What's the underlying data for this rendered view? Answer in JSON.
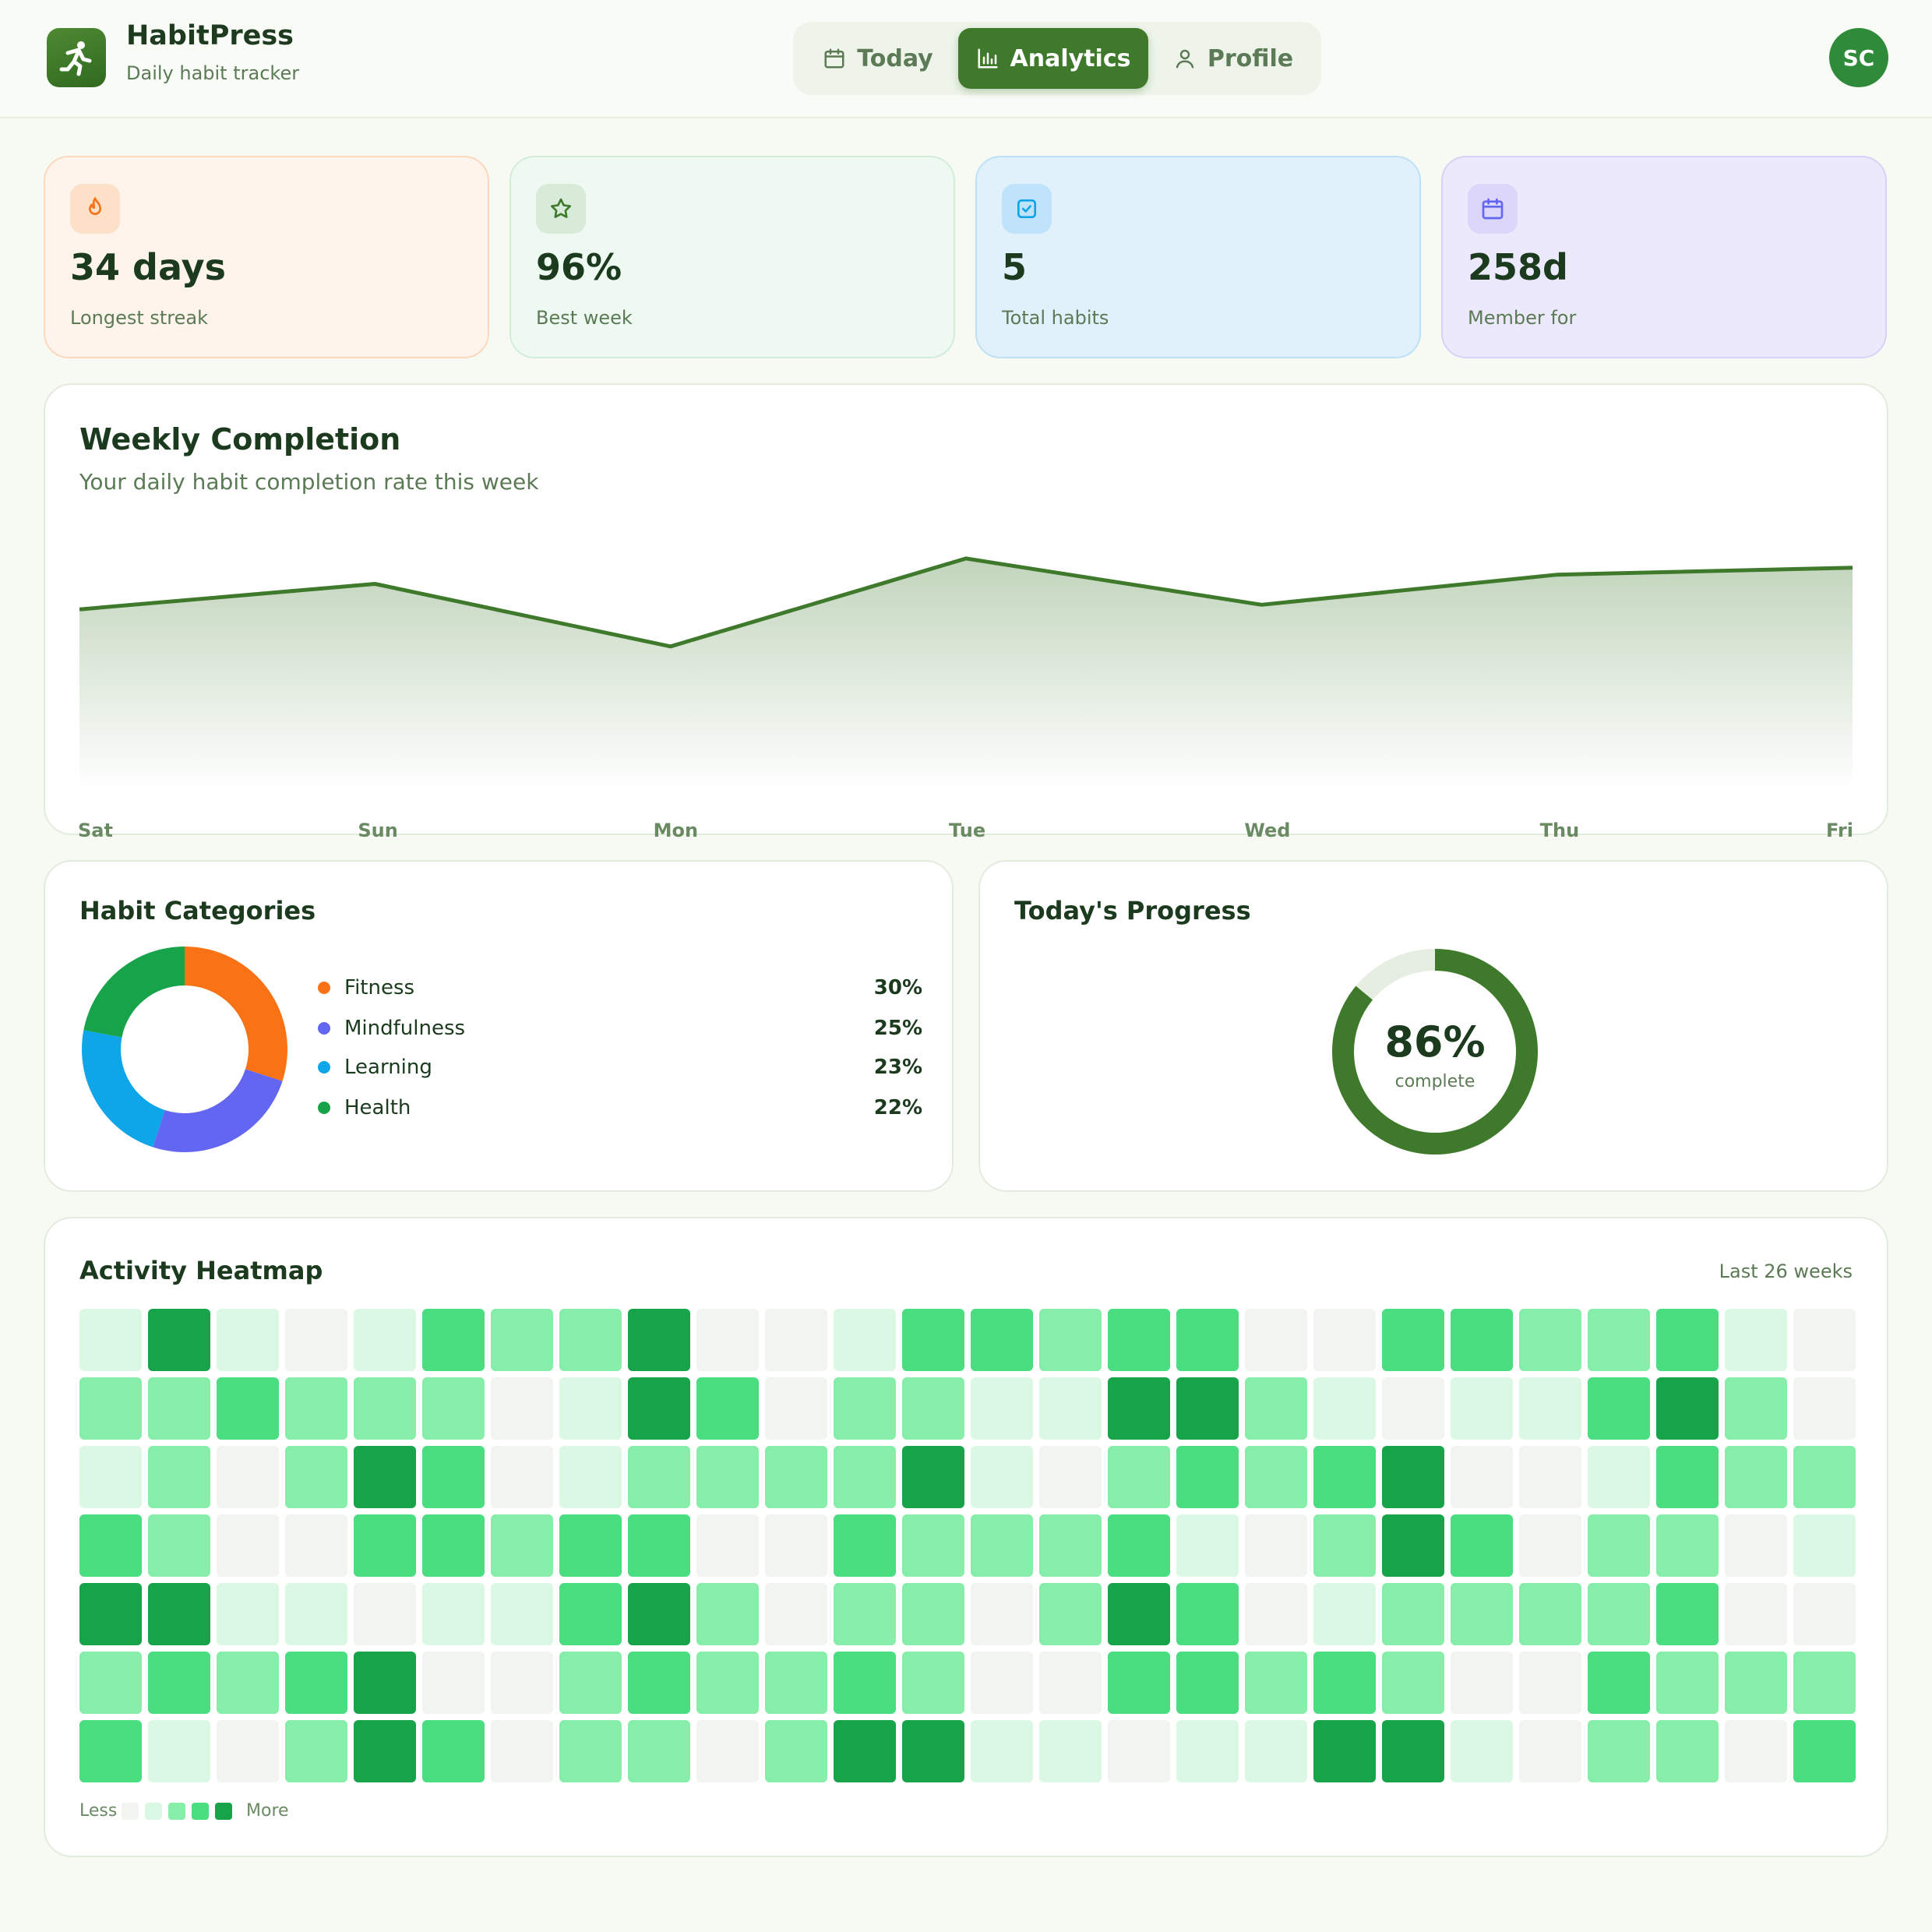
{
  "app": {
    "name": "HabitPress",
    "tagline": "Daily habit tracker",
    "avatar_initials": "SC"
  },
  "nav": {
    "tabs": [
      {
        "label": "Today",
        "icon": "calendar-icon",
        "active": false
      },
      {
        "label": "Analytics",
        "icon": "bar-chart-icon",
        "active": true
      },
      {
        "label": "Profile",
        "icon": "user-icon",
        "active": false
      }
    ]
  },
  "stats": [
    {
      "value": "34 days",
      "label": "Longest streak",
      "icon": "flame-icon",
      "color": "#f97316"
    },
    {
      "value": "96%",
      "label": "Best week",
      "icon": "star-icon",
      "color": "#3f7a2c"
    },
    {
      "value": "5",
      "label": "Total habits",
      "icon": "check-square-icon",
      "color": "#0ea5e9"
    },
    {
      "value": "258d",
      "label": "Member for",
      "icon": "calendar-icon",
      "color": "#6366f1"
    }
  ],
  "weekly": {
    "title": "Weekly Completion",
    "subtitle": "Your daily habit completion rate this week"
  },
  "chart_data": {
    "type": "area",
    "categories": [
      "Sat",
      "Sun",
      "Mon",
      "Tue",
      "Wed",
      "Thu",
      "Fri"
    ],
    "values": [
      78,
      89,
      62,
      100,
      80,
      93,
      96
    ],
    "ylim": [
      0,
      105
    ],
    "grid": false,
    "color": "#3f7a2c"
  },
  "categories": {
    "title": "Habit Categories",
    "items": [
      {
        "name": "Fitness",
        "pct": "30%",
        "value": 30,
        "color": "#f97316"
      },
      {
        "name": "Mindfulness",
        "pct": "25%",
        "value": 25,
        "color": "#6366f1"
      },
      {
        "name": "Learning",
        "pct": "23%",
        "value": 23,
        "color": "#0ea5e9"
      },
      {
        "name": "Health",
        "pct": "22%",
        "value": 22,
        "color": "#16a34a"
      }
    ]
  },
  "progress": {
    "title": "Today's Progress",
    "value": "86%",
    "fraction": 0.86,
    "label": "complete",
    "color": "#3f7a2c"
  },
  "heatmap": {
    "title": "Activity Heatmap",
    "range": "Last 26 weeks",
    "legend_less": "Less",
    "legend_more": "More",
    "rows": [
      [
        1,
        4,
        1,
        0,
        1,
        3,
        2,
        2,
        4,
        0,
        0,
        1,
        3,
        3,
        2,
        3,
        3,
        0,
        0,
        3,
        3,
        2,
        2,
        3,
        1,
        0
      ],
      [
        2,
        2,
        3,
        2,
        2,
        2,
        0,
        1,
        4,
        3,
        0,
        2,
        2,
        1,
        1,
        4,
        4,
        2,
        1,
        0,
        1,
        1,
        3,
        4,
        2,
        0
      ],
      [
        1,
        2,
        0,
        2,
        4,
        3,
        0,
        1,
        2,
        2,
        2,
        2,
        4,
        1,
        0,
        2,
        3,
        2,
        3,
        4,
        0,
        0,
        1,
        3,
        2,
        2
      ],
      [
        3,
        2,
        0,
        0,
        3,
        3,
        2,
        3,
        3,
        0,
        0,
        3,
        2,
        2,
        2,
        3,
        1,
        0,
        2,
        4,
        3,
        0,
        2,
        2,
        0,
        1
      ],
      [
        4,
        4,
        1,
        1,
        0,
        1,
        1,
        3,
        4,
        2,
        0,
        2,
        2,
        0,
        2,
        4,
        3,
        0,
        1,
        2,
        2,
        2,
        2,
        3,
        0,
        0
      ],
      [
        2,
        3,
        2,
        3,
        4,
        0,
        0,
        2,
        3,
        2,
        2,
        3,
        2,
        0,
        0,
        3,
        3,
        2,
        3,
        2,
        0,
        0,
        3,
        2,
        2,
        2
      ],
      [
        3,
        1,
        0,
        2,
        4,
        3,
        0,
        2,
        2,
        0,
        2,
        4,
        4,
        1,
        1,
        0,
        1,
        1,
        4,
        4,
        1,
        0,
        2,
        2,
        0,
        3
      ]
    ]
  }
}
